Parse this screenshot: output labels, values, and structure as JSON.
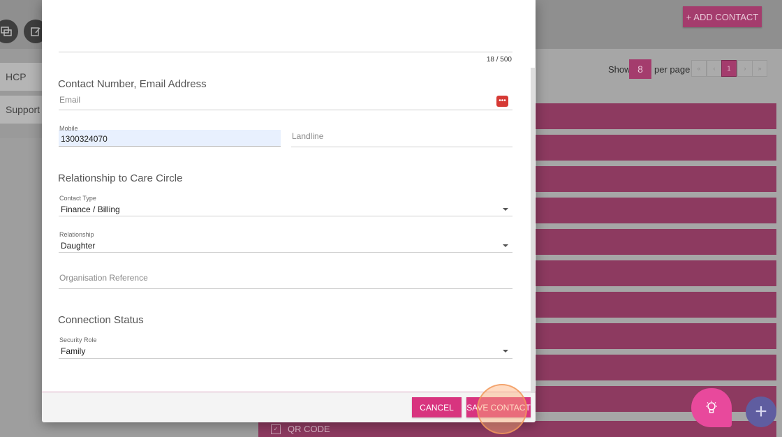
{
  "background": {
    "side_tabs": [
      "HCP",
      "Support A"
    ],
    "add_contact_label": "+ ADD CONTACT",
    "pager": {
      "show_label": "Show",
      "per_page_value": "8",
      "per_page_label": "per page",
      "first": "«",
      "prev": "‹",
      "current_page": "1",
      "next": "›",
      "last": "»"
    },
    "qr_label": "QR CODE"
  },
  "modal": {
    "counter": "18 / 500",
    "contact_section": {
      "title": "Contact Number, Email Address",
      "email_placeholder": "Email",
      "mobile_label": "Mobile",
      "mobile_value": "1300324070",
      "landline_placeholder": "Landline"
    },
    "relationship_section": {
      "title": "Relationship to Care Circle",
      "contact_type_label": "Contact Type",
      "contact_type_value": "Finance / Billing",
      "relationship_label": "Relationship",
      "relationship_value": "Daughter",
      "org_ref_placeholder": "Organisation Reference"
    },
    "connection_section": {
      "title": "Connection Status",
      "security_role_label": "Security Role",
      "security_role_value": "Family"
    },
    "footer": {
      "cancel_label": "CANCEL",
      "save_label": "SAVE CONTACT"
    }
  },
  "colors": {
    "accent": "#d8347f",
    "dimmed_accent": "#8d3a60"
  },
  "icons": [
    "messages-icon",
    "edit-icon",
    "password-manager-icon",
    "lightbulb-icon",
    "plus-icon",
    "checkbox-icon"
  ]
}
